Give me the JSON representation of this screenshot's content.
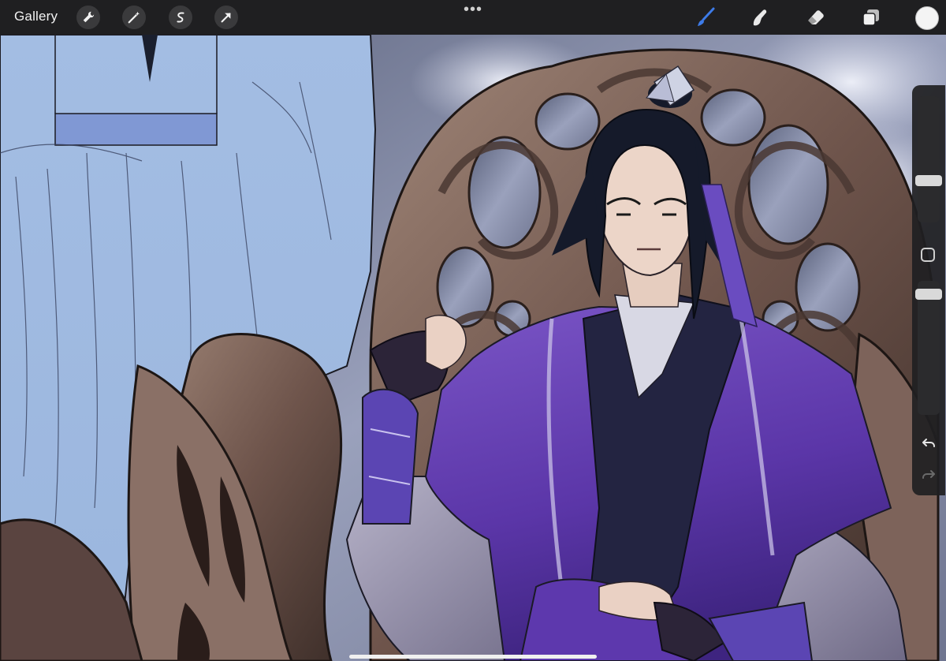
{
  "toolbar": {
    "gallery_label": "Gallery",
    "left_tools": [
      "wrench-icon",
      "magic-wand-icon",
      "selection-icon",
      "transform-arrow-icon"
    ],
    "more_label": "•••",
    "right_tools": [
      "brush-icon",
      "smudge-icon",
      "eraser-icon",
      "layers-icon"
    ],
    "active_tool": "brush-icon",
    "accent_color": "#3d7be8",
    "current_color": "#f4f4f4"
  },
  "sidebar": {
    "brush_size_label": "",
    "opacity_label": "",
    "undo_icon": "undo-arrow-icon",
    "redo_icon": "redo-arrow-icon"
  },
  "canvas": {
    "description_colors": {
      "sky": "#8d94b0",
      "robe_blue": "#a9c4e6",
      "throne_bronze": "#7b6158",
      "purple_robe": "#6b43b3",
      "hair": "#1a1f2e"
    }
  }
}
